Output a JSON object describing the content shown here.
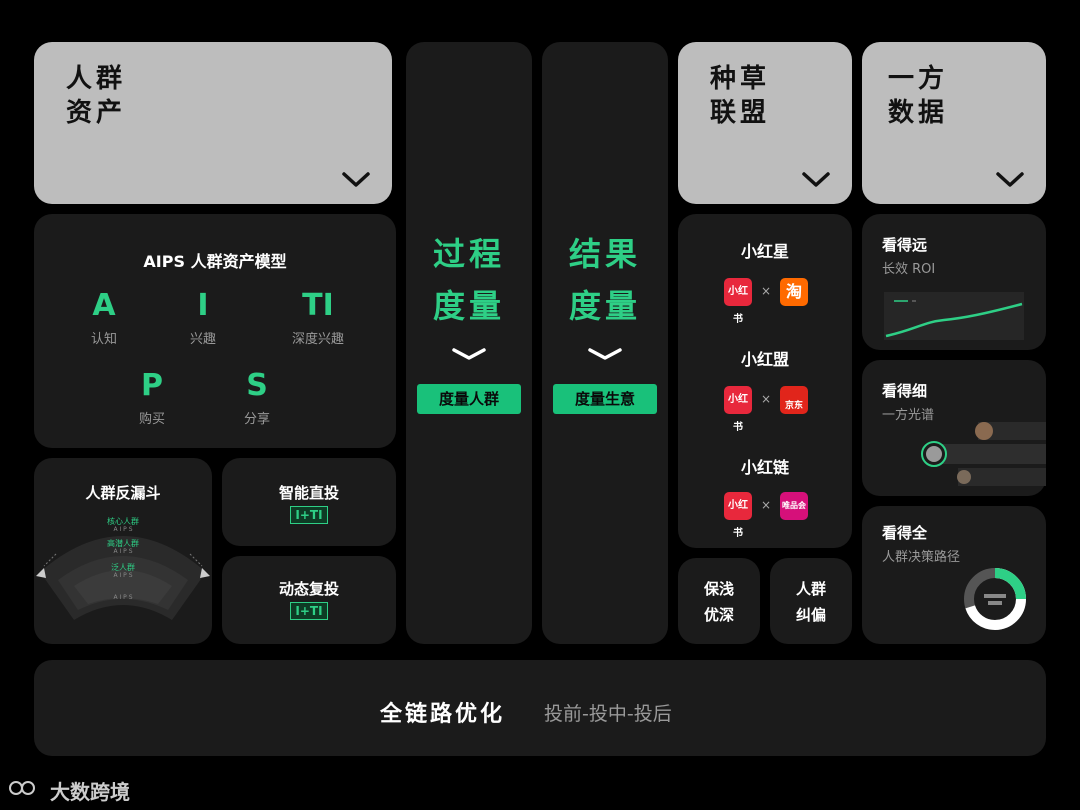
{
  "top_cards": {
    "crowd_assets": {
      "line1": "人群",
      "line2": "资产"
    },
    "seeding_alliance": {
      "line1": "种草",
      "line2": "联盟"
    },
    "first_party_data": {
      "line1": "一方",
      "line2": "数据"
    }
  },
  "aips": {
    "title": "AIPS 人群资产模型",
    "letters": [
      {
        "letter": "A",
        "label": "认知"
      },
      {
        "letter": "I",
        "label": "兴趣"
      },
      {
        "letter": "TI",
        "label": "深度兴趣"
      },
      {
        "letter": "P",
        "label": "购买"
      },
      {
        "letter": "S",
        "label": "分享"
      }
    ]
  },
  "funnel": {
    "title": "人群反漏斗",
    "layers": [
      "核心人群",
      "高潜人群",
      "泛人群"
    ],
    "sublabel": "A I P S"
  },
  "smart_delivery": {
    "title": "智能直投",
    "badge": "I+TI"
  },
  "dynamic_redelivery": {
    "title": "动态复投",
    "badge": "I+TI"
  },
  "process_measure": {
    "line1": "过程",
    "line2": "度量",
    "button": "度量人群"
  },
  "result_measure": {
    "line1": "结果",
    "line2": "度量",
    "button": "度量生意"
  },
  "alliance": {
    "items": [
      {
        "name": "小红星",
        "left_logo": "小红书",
        "right_logo": "淘"
      },
      {
        "name": "小红盟",
        "left_logo": "小红书",
        "right_logo": "京东"
      },
      {
        "name": "小红链",
        "left_logo": "小红书",
        "right_logo": "唯品会"
      }
    ],
    "times": "×"
  },
  "bottom_small": {
    "left": {
      "line1": "保浅",
      "line2": "优深"
    },
    "right": {
      "line1": "人群",
      "line2": "纠偏"
    }
  },
  "see_far": {
    "title": "看得远",
    "subtitle": "长效 ROI"
  },
  "see_fine": {
    "title": "看得细",
    "subtitle": "一方光谱"
  },
  "see_full": {
    "title": "看得全",
    "subtitle": "人群决策路径",
    "ring_fraction": 0.7
  },
  "footer": {
    "main": "全链路优化",
    "sub": "投前-投中-投后"
  },
  "watermark": {
    "text": "大数跨境"
  },
  "colors": {
    "accent": "#2ecf86",
    "button": "#19c17a",
    "card": "#1b1b1b",
    "top_card": "#bdbdbd"
  }
}
